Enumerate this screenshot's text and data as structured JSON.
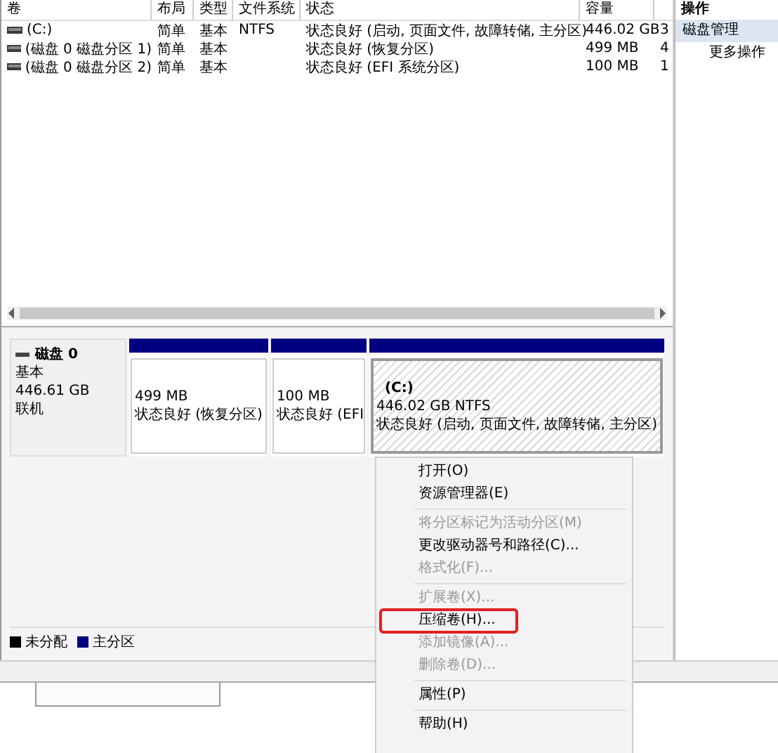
{
  "volume_table": {
    "columns": [
      "卷",
      "布局",
      "类型",
      "文件系统",
      "状态",
      "容量"
    ],
    "rows": [
      {
        "cells": [
          "(C:)",
          "简单",
          "基本",
          "NTFS",
          "状态良好 (启动, 页面文件, 故障转储, 主分区)",
          "446.02 GB",
          "3"
        ]
      },
      {
        "cells": [
          "(磁盘 0 磁盘分区 1)",
          "简单",
          "基本",
          "",
          "状态良好 (恢复分区)",
          "499 MB",
          "4"
        ]
      },
      {
        "cells": [
          "(磁盘 0 磁盘分区 2)",
          "简单",
          "基本",
          "",
          "状态良好 (EFI 系统分区)",
          "100 MB",
          "1"
        ]
      }
    ]
  },
  "actions_pane": {
    "title": "操作",
    "items": [
      {
        "label": "磁盘管理",
        "selected": true
      },
      {
        "label": "更多操作",
        "selected": false
      }
    ]
  },
  "disk": {
    "name": "磁盘 0",
    "type": "基本",
    "size": "446.61 GB",
    "status": "联机",
    "partitions": [
      {
        "size": "499 MB",
        "status": "状态良好 (恢复分区)",
        "selected": false
      },
      {
        "size": "100 MB",
        "status": "状态良好 (EFI",
        "selected": false
      },
      {
        "label": "(C:)",
        "size": "446.02 GB NTFS",
        "status": "状态良好 (启动, 页面文件, 故障转储, 主分区)",
        "selected": true
      }
    ]
  },
  "legend": [
    {
      "label": "未分配",
      "color": "#000000"
    },
    {
      "label": "主分区",
      "color": "#000080"
    }
  ],
  "context_menu": [
    {
      "kind": "item",
      "label": "打开(O)",
      "disabled": false,
      "highlighted": false
    },
    {
      "kind": "item",
      "label": "资源管理器(E)",
      "disabled": false,
      "highlighted": false
    },
    {
      "kind": "separator"
    },
    {
      "kind": "item",
      "label": "将分区标记为活动分区(M)",
      "disabled": true,
      "highlighted": false
    },
    {
      "kind": "item",
      "label": "更改驱动器号和路径(C)...",
      "disabled": false,
      "highlighted": false
    },
    {
      "kind": "item",
      "label": "格式化(F)...",
      "disabled": true,
      "highlighted": false
    },
    {
      "kind": "separator"
    },
    {
      "kind": "item",
      "label": "扩展卷(X)...",
      "disabled": true,
      "highlighted": false
    },
    {
      "kind": "item",
      "label": "压缩卷(H)...",
      "disabled": false,
      "highlighted": true
    },
    {
      "kind": "item",
      "label": "添加镜像(A)...",
      "disabled": true,
      "highlighted": false
    },
    {
      "kind": "item",
      "label": "删除卷(D)...",
      "disabled": true,
      "highlighted": false
    },
    {
      "kind": "separator"
    },
    {
      "kind": "item",
      "label": "属性(P)",
      "disabled": false,
      "highlighted": false
    },
    {
      "kind": "separator"
    },
    {
      "kind": "item",
      "label": "帮助(H)",
      "disabled": false,
      "highlighted": false
    }
  ]
}
